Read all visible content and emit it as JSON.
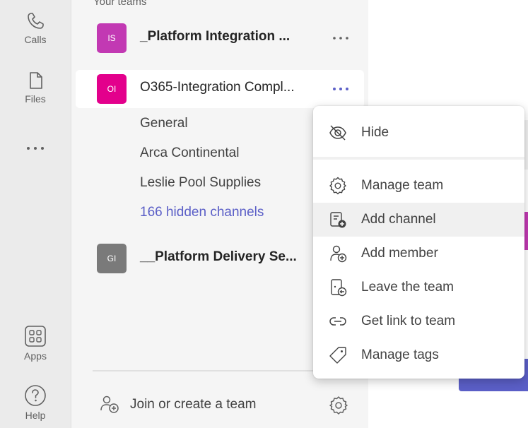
{
  "rail": {
    "calls_label": "Calls",
    "files_label": "Files",
    "apps_label": "Apps",
    "help_label": "Help"
  },
  "teams_pane": {
    "section_title": "Your teams",
    "teams": [
      {
        "initials": "IS",
        "name": "_Platform Integration ...",
        "color": "#c239b3"
      },
      {
        "initials": "OI",
        "name": "O365-Integration Compl...",
        "color": "#e3008c"
      },
      {
        "initials": "GI",
        "name": "__Platform Delivery Se...",
        "color": "#7a7a7a"
      }
    ],
    "channels": [
      "General",
      "Arca Continental",
      "Leslie Pool Supplies"
    ],
    "hidden_channels": "166 hidden channels",
    "join_label": "Join or create a team"
  },
  "context_menu": {
    "items": [
      {
        "label": "Hide",
        "icon": "eye-off-icon"
      },
      {
        "label": "Manage team",
        "icon": "gear-icon"
      },
      {
        "label": "Add channel",
        "icon": "add-channel-icon"
      },
      {
        "label": "Add member",
        "icon": "add-person-icon"
      },
      {
        "label": "Leave the team",
        "icon": "leave-door-icon"
      },
      {
        "label": "Get link to team",
        "icon": "link-icon"
      },
      {
        "label": "Manage tags",
        "icon": "tag-icon"
      }
    ]
  },
  "colors": {
    "accent": "#5b5fc7",
    "rail_bg": "#ebebeb",
    "pane_bg": "#f5f5f5"
  }
}
